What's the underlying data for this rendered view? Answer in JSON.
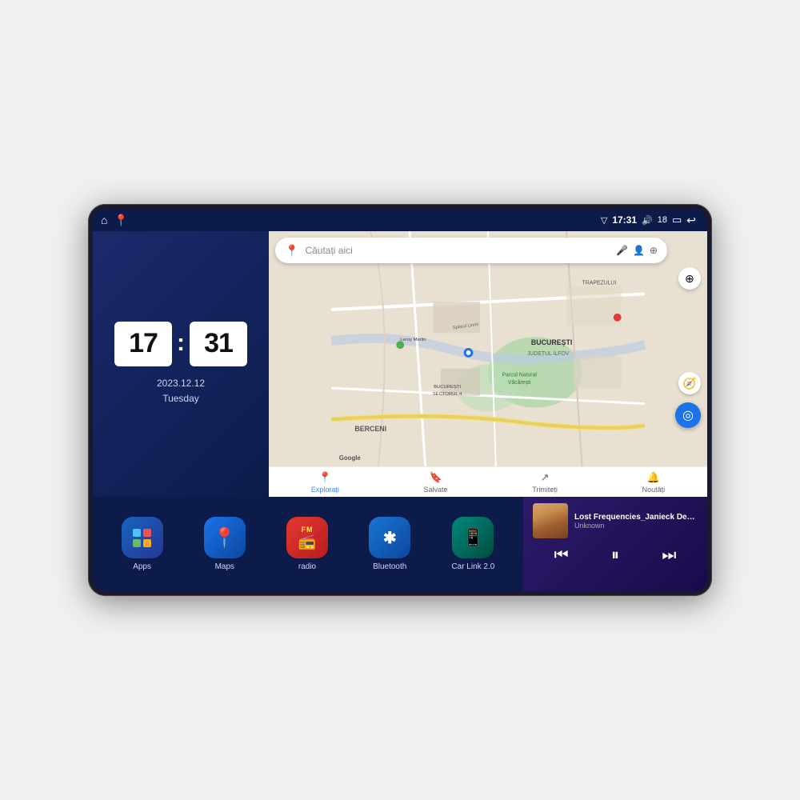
{
  "device": {
    "status_bar": {
      "time": "17:31",
      "signal": "18",
      "left_icons": [
        "home",
        "maps-pin"
      ]
    },
    "clock": {
      "hours": "17",
      "minutes": "31",
      "date": "2023.12.12",
      "day": "Tuesday"
    },
    "map": {
      "search_placeholder": "Căutați aici",
      "nav_items": [
        {
          "label": "Explorați",
          "icon": "📍",
          "active": true
        },
        {
          "label": "Salvate",
          "icon": "🔖",
          "active": false
        },
        {
          "label": "Trimiteți",
          "icon": "↗",
          "active": false
        },
        {
          "label": "Noutăți",
          "icon": "🔔",
          "active": false
        }
      ],
      "labels": {
        "berceni": "BERCENI",
        "bucuresti": "BUCUREȘTI",
        "judet": "JUDEȚUL ILFOV",
        "trapezului": "TRAPEZULUI",
        "sector4": "BUCUREȘTI\nSECTORUL 4",
        "leroy": "Leroy Merlin",
        "parcul": "Parcul Natural Văcărești",
        "google": "Google"
      }
    },
    "apps": [
      {
        "label": "Apps",
        "icon": "apps",
        "color": "icon-apps"
      },
      {
        "label": "Maps",
        "icon": "maps",
        "color": "icon-maps"
      },
      {
        "label": "radio",
        "icon": "radio",
        "color": "icon-radio"
      },
      {
        "label": "Bluetooth",
        "icon": "bluetooth",
        "color": "icon-bluetooth"
      },
      {
        "label": "Car Link 2.0",
        "icon": "carlink",
        "color": "icon-carlink"
      }
    ],
    "music": {
      "title": "Lost Frequencies_Janieck Devy-...",
      "artist": "Unknown",
      "controls": {
        "prev": "⏮",
        "play": "⏸",
        "next": "⏭"
      }
    }
  }
}
